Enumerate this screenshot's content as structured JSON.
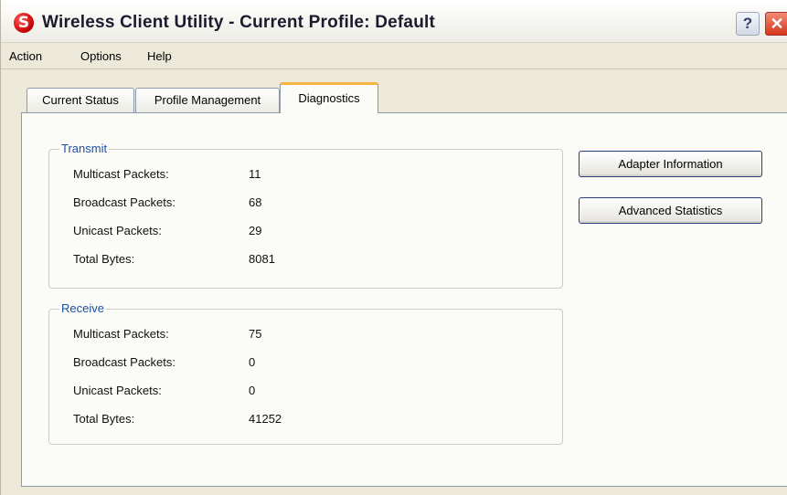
{
  "window": {
    "title": "Wireless Client Utility - Current Profile: Default",
    "icon": "app-logo-icon",
    "help_button": "?",
    "close_button": "✕"
  },
  "menu": {
    "items": [
      {
        "label": "Action"
      },
      {
        "label": "Options"
      },
      {
        "label": "Help"
      }
    ]
  },
  "tabs": [
    {
      "label": "Current Status"
    },
    {
      "label": "Profile Management"
    },
    {
      "label": "Diagnostics",
      "selected": true
    }
  ],
  "transmit": {
    "legend": "Transmit",
    "rows": [
      {
        "label": "Multicast Packets:",
        "value": "11"
      },
      {
        "label": "Broadcast Packets:",
        "value": "68"
      },
      {
        "label": "Unicast Packets:",
        "value": "29"
      },
      {
        "label": "Total Bytes:",
        "value": "8081"
      }
    ]
  },
  "receive": {
    "legend": "Receive",
    "rows": [
      {
        "label": "Multicast Packets:",
        "value": "75"
      },
      {
        "label": "Broadcast Packets:",
        "value": "0"
      },
      {
        "label": "Unicast Packets:",
        "value": "0"
      },
      {
        "label": "Total Bytes:",
        "value": "41252"
      }
    ]
  },
  "buttons": {
    "adapter_information": "Adapter Information",
    "advanced_statistics": "Advanced Statistics"
  },
  "colors": {
    "accent_tab": "#f3b43f",
    "group_legend": "#1f4fa3",
    "close_button": "#d3361b"
  }
}
